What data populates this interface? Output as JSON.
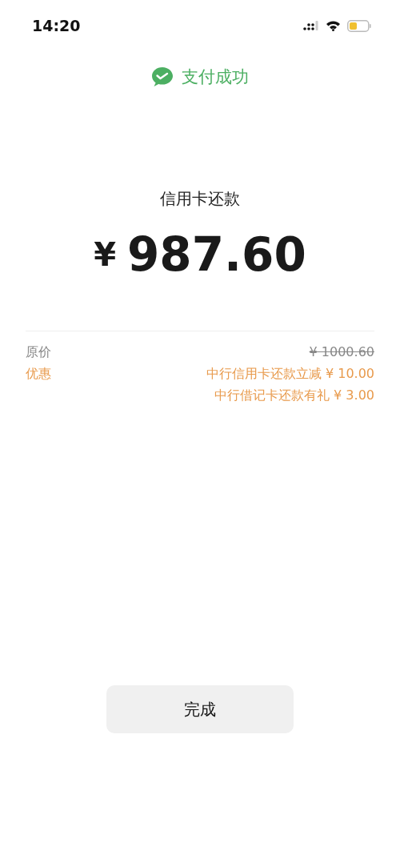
{
  "status_bar": {
    "time": "14:20"
  },
  "header": {
    "title": "支付成功"
  },
  "payment": {
    "title": "信用卡还款",
    "currency": "¥",
    "amount": "987.60"
  },
  "details": [
    {
      "kind": "original",
      "label": "原价",
      "values": [
        "¥ 1000.60"
      ]
    },
    {
      "kind": "discount",
      "label": "优惠",
      "values": [
        "中行信用卡还款立减 ¥ 10.00",
        "中行借记卡还款有礼 ¥ 3.00"
      ]
    }
  ],
  "button": {
    "label": "完成"
  }
}
